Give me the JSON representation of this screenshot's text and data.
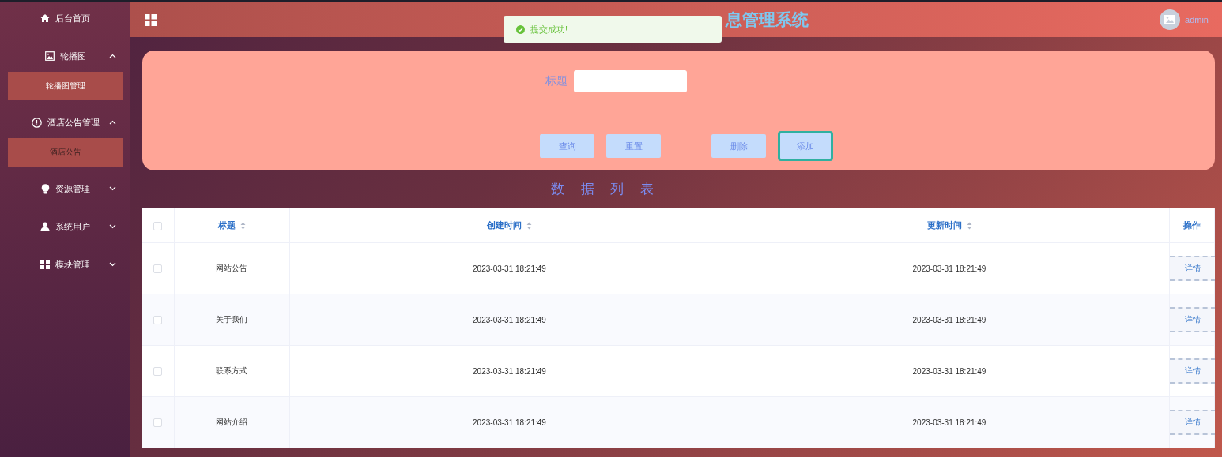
{
  "sidebar": {
    "items": [
      {
        "label": "后台首页"
      },
      {
        "label": "轮播图",
        "expanded": true,
        "children": [
          {
            "label": "轮播图管理",
            "selected": false
          }
        ]
      },
      {
        "label": "酒店公告管理",
        "expanded": true,
        "children": [
          {
            "label": "酒店公告",
            "selected": true
          }
        ]
      },
      {
        "label": "资源管理",
        "expanded": false
      },
      {
        "label": "系统用户",
        "expanded": false
      },
      {
        "label": "模块管理",
        "expanded": false
      }
    ]
  },
  "header": {
    "title": "息管理系统",
    "user": "admin"
  },
  "toast": {
    "message": "提交成功!"
  },
  "search": {
    "label": "标题",
    "buttons": [
      {
        "label": "查询",
        "focused": false
      },
      {
        "label": "重置",
        "focused": false
      },
      {
        "label": "删除",
        "focused": false
      },
      {
        "label": "添加",
        "focused": true
      }
    ]
  },
  "list_title": "数 据 列 表",
  "table": {
    "columns": [
      {
        "label": "标题",
        "sortable": true
      },
      {
        "label": "创建时间",
        "sortable": true
      },
      {
        "label": "更新时间",
        "sortable": true
      },
      {
        "label": "操作",
        "sortable": false
      }
    ],
    "header_checked": false,
    "rows": [
      {
        "checked": false,
        "cells": [
          "网站公告",
          "2023-03-31 18:21:49",
          "2023-03-31 18:21:49"
        ],
        "action": "详情"
      },
      {
        "checked": false,
        "cells": [
          "关于我们",
          "2023-03-31 18:21:49",
          "2023-03-31 18:21:49"
        ],
        "action": "详情"
      },
      {
        "checked": false,
        "cells": [
          "联系方式",
          "2023-03-31 18:21:49",
          "2023-03-31 18:21:49"
        ],
        "action": "详情"
      },
      {
        "checked": false,
        "cells": [
          "网站介绍",
          "2023-03-31 18:21:49",
          "2023-03-31 18:21:49"
        ],
        "action": "详情"
      }
    ]
  }
}
